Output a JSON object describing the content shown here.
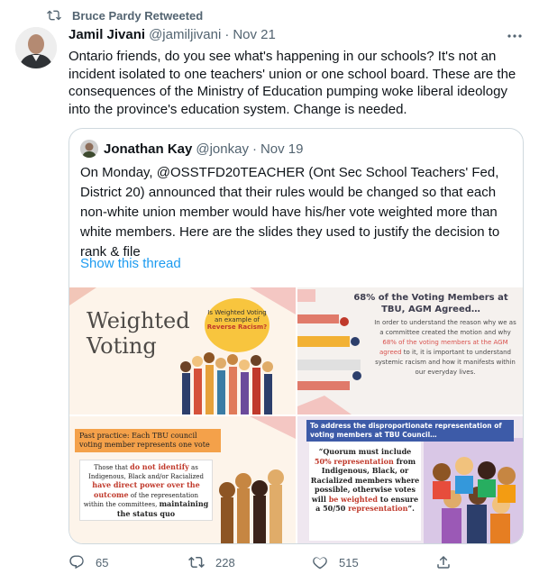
{
  "retweet": {
    "label": "Bruce Pardy Retweeted"
  },
  "tweet": {
    "author_name": "Jamil Jivani",
    "handle": "@jamiljivani",
    "separator": "·",
    "date": "Nov 21",
    "text": "Ontario friends, do you see what's happening in our schools? It's not an incident isolated to one teachers' union or one school board. These are the consequences of the Ministry of Education pumping woke liberal ideology into the province's education system. Change is needed."
  },
  "quoted": {
    "author_name": "Jonathan Kay",
    "handle": "@jonkay",
    "separator": "·",
    "date": "Nov 19",
    "text": "On Monday, @OSSTFD20TEACHER (Ont Sec School Teachers' Fed, District 20) announced that their rules would be changed so that each non-white union member would have his/her vote weighted more than white members. Here are the slides they used to justify the decision to rank & file",
    "show_thread": "Show this thread",
    "slides": {
      "s1": {
        "title": "Weighted Voting",
        "bubble_a": "Is Weighted Voting an example of",
        "bubble_b": "Reverse Racism?"
      },
      "s2": {
        "title": "68% of the Voting Members at TBU, AGM Agreed…",
        "body_a": "In order to understand the reason why we as a committee created the motion and why",
        "body_hl": "68% of the voting members at the AGM agreed",
        "body_b": "to it, it is important to understand systemic racism and how it manifests within our everyday lives."
      },
      "s3": {
        "label": "Past practice: Each TBU council voting member represents one vote",
        "box_a": "Those that",
        "box_red1": "do not identify",
        "box_b": "as Indigenous, Black and/or Racialized",
        "box_red2": "have direct power over the outcome",
        "box_c": "of the representation within the committees,",
        "box_bold": "maintaining the status quo"
      },
      "s4": {
        "title": "To address the disproportionate representation of voting members at TBU Council…",
        "quote_a": "“Quorum must include",
        "quote_red1": "50% representation",
        "quote_b": "from Indigenous, Black, or Racialized members where possible, otherwise votes will",
        "quote_red2": "be weighted",
        "quote_c": "to ensure a 50/50",
        "quote_red3": "representation",
        "quote_d": "”."
      }
    }
  },
  "actions": {
    "replies": "65",
    "retweets": "228",
    "likes": "515"
  },
  "colors": {
    "link": "#1d9bf0",
    "secondary_text": "#536471",
    "border": "#cfd9de"
  },
  "icons": [
    "retweet-icon",
    "more-icon",
    "reply-icon",
    "like-icon",
    "share-icon"
  ]
}
